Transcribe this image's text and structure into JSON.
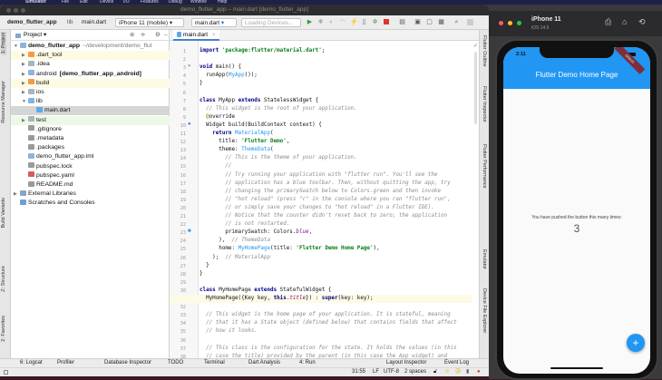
{
  "menubar": {
    "items": [
      "Simulator",
      "File",
      "Edit",
      "Device",
      "I/O",
      "Features",
      "Debug",
      "Window",
      "Help"
    ]
  },
  "ide": {
    "window_title": "demo_flutter_app – main.dart [demo_flutter_app]",
    "breadcrumb": [
      "demo_flutter_app",
      "lib",
      "main.dart"
    ],
    "device_selector": "iPhone 11 (mobile)",
    "run_config": "main.dart",
    "devices_combo": "Loading Devices...",
    "project_panel": {
      "title": "Project",
      "tree": [
        {
          "label": "demo_flutter_app",
          "suffix": "~/development/demo_flut",
          "depth": 0,
          "arrow": "down",
          "icon": "module-folder",
          "bold": true
        },
        {
          "label": ".dart_tool",
          "depth": 1,
          "arrow": "right",
          "icon": "folder-orange",
          "highlight": "yellow"
        },
        {
          "label": ".idea",
          "depth": 1,
          "arrow": "right",
          "icon": "folder-grey"
        },
        {
          "label": "android",
          "suffix": "[demo_flutter_app_android]",
          "depth": 1,
          "arrow": "right",
          "icon": "module-folder"
        },
        {
          "label": "build",
          "depth": 1,
          "arrow": "right",
          "icon": "folder-orange",
          "highlight": "yellow"
        },
        {
          "label": "ios",
          "depth": 1,
          "arrow": "right",
          "icon": "folder-grey"
        },
        {
          "label": "lib",
          "depth": 1,
          "arrow": "down",
          "icon": "folder-blue"
        },
        {
          "label": "main.dart",
          "depth": 2,
          "icon": "dart-file",
          "selected": true
        },
        {
          "label": "test",
          "depth": 1,
          "arrow": "right",
          "icon": "folder-test",
          "highlight": "green"
        },
        {
          "label": ".gitignore",
          "depth": 1,
          "icon": "file"
        },
        {
          "label": ".metadata",
          "depth": 1,
          "icon": "file"
        },
        {
          "label": ".packages",
          "depth": 1,
          "icon": "file"
        },
        {
          "label": "demo_flutter_app.iml",
          "depth": 1,
          "icon": "iml-file"
        },
        {
          "label": "pubspec.lock",
          "depth": 1,
          "icon": "file"
        },
        {
          "label": "pubspec.yaml",
          "depth": 1,
          "icon": "yaml-file"
        },
        {
          "label": "README.md",
          "depth": 1,
          "icon": "file"
        },
        {
          "label": "External Libraries",
          "depth": 0,
          "arrow": "right",
          "icon": "library"
        },
        {
          "label": "Scratches and Consoles",
          "depth": 0,
          "icon": "scratches"
        }
      ]
    },
    "left_strip": [
      "1: Project",
      "Resource Manager",
      "Build Variants",
      "Z: Structure",
      "2: Favorites"
    ],
    "right_strip": [
      "Flutter Outline",
      "Flutter Inspector",
      "Flutter Performance",
      "Emulator",
      "Device File Explorer"
    ],
    "editor_tab": "main.dart",
    "code": [
      [
        [
          "k",
          "import "
        ],
        [
          "s",
          "'package:flutter/material.dart'"
        ],
        [
          "p",
          ";"
        ]
      ],
      [],
      [
        [
          "k",
          "void "
        ],
        [
          "p",
          "main() {"
        ]
      ],
      [
        [
          "p",
          "  runApp("
        ],
        [
          "t",
          "MyApp"
        ],
        [
          "p",
          "());"
        ]
      ],
      [
        [
          "p",
          "}"
        ]
      ],
      [],
      [
        [
          "k",
          "class "
        ],
        [
          "p",
          "MyApp "
        ],
        [
          "k",
          "extends "
        ],
        [
          "p",
          "StatelessWidget {"
        ]
      ],
      [
        [
          "c",
          "  // This widget is the root of your application."
        ]
      ],
      [
        [
          "a",
          "  @"
        ],
        [
          "p",
          "override"
        ]
      ],
      [
        [
          "p",
          "  Widget build(BuildContext context) {"
        ]
      ],
      [
        [
          "k",
          "    return "
        ],
        [
          "t",
          "MaterialApp"
        ],
        [
          "p",
          "("
        ]
      ],
      [
        [
          "p",
          "      title: "
        ],
        [
          "s",
          "'Flutter Demo'"
        ],
        [
          "p",
          ","
        ]
      ],
      [
        [
          "p",
          "      theme: "
        ],
        [
          "t",
          "ThemeData"
        ],
        [
          "p",
          "("
        ]
      ],
      [
        [
          "c",
          "        // This is the theme of your application."
        ]
      ],
      [
        [
          "c",
          "        //"
        ]
      ],
      [
        [
          "c",
          "        // Try running your application with \"flutter run\". You'll see the"
        ]
      ],
      [
        [
          "c",
          "        // application has a blue toolbar. Then, without quitting the app, try"
        ]
      ],
      [
        [
          "c",
          "        // changing the primarySwatch below to Colors.green and then invoke"
        ]
      ],
      [
        [
          "c",
          "        // \"hot reload\" (press \"r\" in the console where you ran \"flutter run\","
        ]
      ],
      [
        [
          "c",
          "        // or simply save your changes to \"hot reload\" in a Flutter IDE)."
        ]
      ],
      [
        [
          "c",
          "        // Notice that the counter didn't reset back to zero; the application"
        ]
      ],
      [
        [
          "c",
          "        // is not restarted."
        ]
      ],
      [
        [
          "p",
          "        primarySwatch: Colors."
        ],
        [
          "f",
          "blue"
        ],
        [
          "p",
          ","
        ]
      ],
      [
        [
          "p",
          "      ),  "
        ],
        [
          "c",
          "// ThemeData"
        ]
      ],
      [
        [
          "p",
          "      home: "
        ],
        [
          "t",
          "MyHomePage"
        ],
        [
          "p",
          "(title: "
        ],
        [
          "s",
          "'Flutter Demo Home Page'"
        ],
        [
          "p",
          "),"
        ]
      ],
      [
        [
          "p",
          "    );  "
        ],
        [
          "c",
          "// MaterialApp"
        ]
      ],
      [
        [
          "p",
          "  }"
        ]
      ],
      [
        [
          "p",
          "}"
        ]
      ],
      [],
      [
        [
          "k",
          "class "
        ],
        [
          "p",
          "MyHomePage "
        ],
        [
          "k",
          "extends "
        ],
        [
          "p",
          "StatefulWidget {"
        ]
      ],
      [
        [
          "p",
          "  MyHomePage({Key key, "
        ],
        [
          "k",
          "this"
        ],
        [
          "p",
          "."
        ],
        [
          "f",
          "title"
        ],
        [
          "p",
          "}) : "
        ],
        [
          "k",
          "super"
        ],
        [
          "p",
          "(key: key);"
        ]
      ],
      [],
      [
        [
          "c",
          "  // This widget is the home page of your application. It is stateful, meaning"
        ]
      ],
      [
        [
          "c",
          "  // that it has a State object (defined below) that contains fields that affect"
        ]
      ],
      [
        [
          "c",
          "  // how it looks."
        ]
      ],
      [],
      [
        [
          "c",
          "  // This class is the configuration for the state. It holds the values (in this"
        ]
      ],
      [
        [
          "c",
          "  // case the title) provided by the parent (in this case the App widget) and"
        ]
      ]
    ],
    "current_line": 31,
    "bottom_tabs": [
      "6: Logcat",
      "Profiler",
      "Database Inspector",
      "TODO",
      "Terminal",
      "Dart Analysis",
      "4: Run"
    ],
    "bottom_tabs_right": [
      "Layout Inspector",
      "Event Log"
    ],
    "status": {
      "position": "31:55",
      "line_sep": "LF",
      "encoding": "UTF-8",
      "indent": "2 spaces"
    }
  },
  "simulator": {
    "device": "iPhone 11",
    "os": "iOS 14.5",
    "time": "2:11",
    "debug_banner": "DEBUG",
    "app_title": "Flutter Demo Home Page",
    "counter_label": "You have pushed the button this many times:",
    "counter_value": "3",
    "fab_label": "+"
  },
  "colors": {
    "accent": "#2196f3",
    "keyword": "#000080",
    "string": "#067d17",
    "comment": "#8c8c8c"
  }
}
